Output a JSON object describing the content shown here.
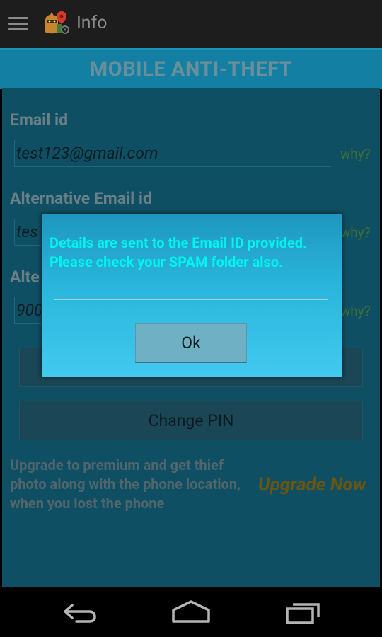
{
  "actionbar": {
    "title": "Info",
    "menu_icon": "hamburger-menu-icon",
    "logo_icon": "anti-theft-logo-icon"
  },
  "banner": {
    "title": "MOBILE ANTI-THEFT"
  },
  "form": {
    "email_label": "Email id",
    "email_value": "test123@gmail.com",
    "email_why": "why?",
    "alt_email_label": "Alternative Email id",
    "alt_email_value": "tes",
    "alt_email_why": "why?",
    "alt_phone_label": "Alte",
    "alt_phone_value": "900",
    "alt_phone_why": "why?"
  },
  "buttons": {
    "change_pin_label": "Change PIN"
  },
  "upgrade": {
    "text": "Upgrade to premium and get thief photo along with the phone location, when you lost the phone",
    "link": "Upgrade Now"
  },
  "dialog": {
    "message": "Details are sent to the Email ID provided. Please check your SPAM folder also.",
    "ok_label": "Ok"
  },
  "navbar": {
    "back_icon": "back-icon",
    "home_icon": "home-icon",
    "recents_icon": "recent-apps-icon"
  },
  "colors": {
    "banner": "#137fa2",
    "dialog_text": "#00f5f0",
    "upgrade_link": "#6a5412"
  }
}
